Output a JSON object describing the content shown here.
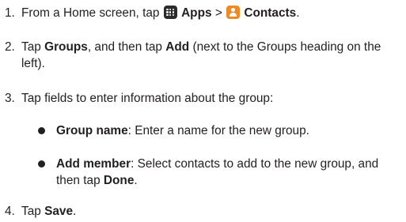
{
  "steps": [
    {
      "number": "1.",
      "prefix": "From a Home screen, tap ",
      "apps_icon": "apps-grid-icon",
      "apps_label": "Apps",
      "separator": " > ",
      "contacts_icon": "contacts-person-icon",
      "contacts_label": "Contacts",
      "suffix": "."
    },
    {
      "number": "2.",
      "t1": "Tap ",
      "b1": "Groups",
      "t2": ", and then tap ",
      "b2": "Add",
      "t3": " (next to the Groups heading on the left)."
    },
    {
      "number": "3.",
      "text": "Tap fields to enter information about the group:",
      "bullets": [
        {
          "label": "Group name",
          "text": ": Enter a name for the new group."
        },
        {
          "label": "Add member",
          "text": ": Select contacts to add to the new group, and then tap ",
          "bold_end": "Done",
          "end": "."
        }
      ]
    },
    {
      "number": "4.",
      "t1": "Tap ",
      "b1": "Save",
      "t2": "."
    }
  ]
}
